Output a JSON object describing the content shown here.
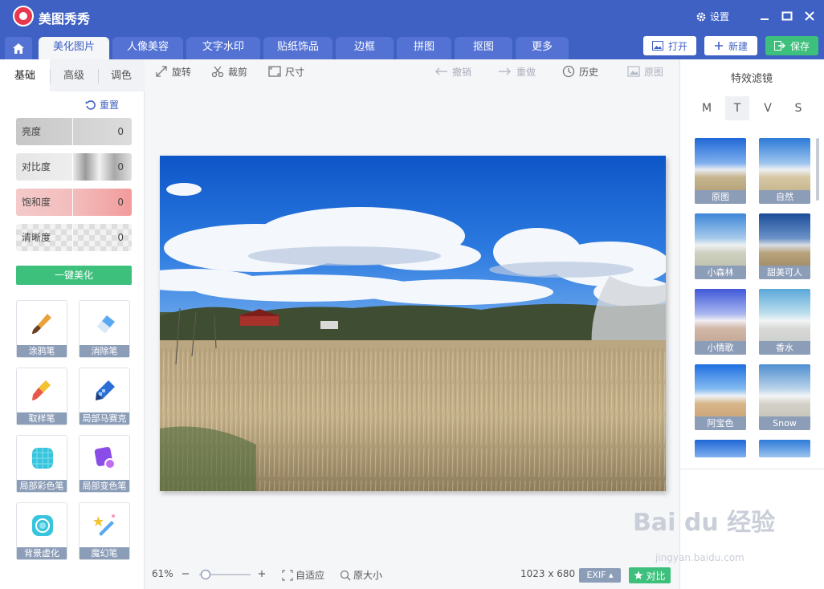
{
  "app": {
    "title": "美图秀秀",
    "settings_label": "设置"
  },
  "tabs": [
    {
      "label": "美化图片"
    },
    {
      "label": "人像美容"
    },
    {
      "label": "文字水印"
    },
    {
      "label": "贴纸饰品"
    },
    {
      "label": "边框"
    },
    {
      "label": "拼图"
    },
    {
      "label": "抠图"
    },
    {
      "label": "更多"
    }
  ],
  "actions": {
    "open": "打开",
    "new": "新建",
    "save": "保存"
  },
  "left_panel": {
    "subtabs": [
      "基础",
      "高级",
      "调色"
    ],
    "reset_label": "重置",
    "sliders": [
      {
        "label": "亮度",
        "value": "0"
      },
      {
        "label": "对比度",
        "value": "0"
      },
      {
        "label": "饱和度",
        "value": "0"
      },
      {
        "label": "清晰度",
        "value": "0"
      }
    ],
    "beautify_label": "一键美化",
    "tools": [
      "涂鸦笔",
      "消除笔",
      "取样笔",
      "局部马赛克",
      "局部彩色笔",
      "局部变色笔",
      "背景虚化",
      "魔幻笔"
    ]
  },
  "toolbar": {
    "rotate": "旋转",
    "crop": "裁剪",
    "size": "尺寸",
    "undo": "撤销",
    "redo": "重做",
    "history": "历史",
    "original": "原图"
  },
  "bottom": {
    "zoom": "61%",
    "fit": "自适应",
    "actual_size": "原大小",
    "dimensions": "1023 x 680",
    "exif": "EXIF",
    "compare": "对比",
    "zoom_level": 0.1
  },
  "right_panel": {
    "title": "特效滤镜",
    "mode_tabs": [
      "M",
      "T",
      "V",
      "S"
    ],
    "filters": [
      "原图",
      "自然",
      "小森林",
      "甜美可人",
      "小情歌",
      "香水",
      "阿宝色",
      "Snow"
    ]
  },
  "watermark": {
    "text": "Bai du 经验",
    "sub": "jingyan.baidu.com"
  },
  "colors": {
    "brand": "#3f61c4",
    "accent_green": "#3ec07d",
    "label_bg": "#8c9db8"
  }
}
